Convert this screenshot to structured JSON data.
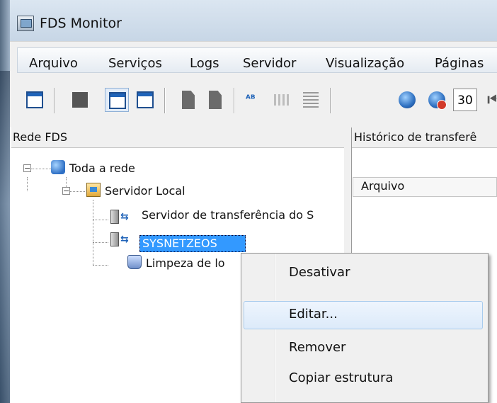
{
  "window": {
    "title": "FDS Monitor"
  },
  "menubar": {
    "items": [
      "Arquivo",
      "Serviços",
      "Logs",
      "Servidor",
      "Visualização",
      "Páginas"
    ]
  },
  "toolbar": {
    "buttons": [
      "window-icon",
      "stop-icon",
      "view-details-icon",
      "view-list-icon",
      "doc-icon",
      "doc2-icon",
      "text-icon",
      "dots-icon",
      "grid-icon",
      "globe-icon",
      "globe-alert-icon"
    ],
    "refresh_interval": "30"
  },
  "left_pane": {
    "title": "Rede FDS",
    "tree": [
      {
        "label": "Toda a rede",
        "level": 0,
        "icon": "network-icon"
      },
      {
        "label": "Servidor Local",
        "level": 1,
        "icon": "local-server-icon"
      },
      {
        "label": "Servidor de transferência do S",
        "level": 2,
        "icon": "transfer-server-icon"
      },
      {
        "label": "SYSNETZEOS",
        "level": 2,
        "icon": "transfer-server-icon",
        "selected": true
      },
      {
        "label": "Limpeza de lo",
        "level": 2,
        "icon": "cleanup-icon"
      }
    ]
  },
  "right_pane": {
    "title": "Histórico de transferê",
    "column": "Arquivo"
  },
  "context_menu": {
    "items": [
      "Desativar",
      "Editar...",
      "Remover",
      "Copiar estrutura"
    ],
    "highlighted": "Editar..."
  }
}
